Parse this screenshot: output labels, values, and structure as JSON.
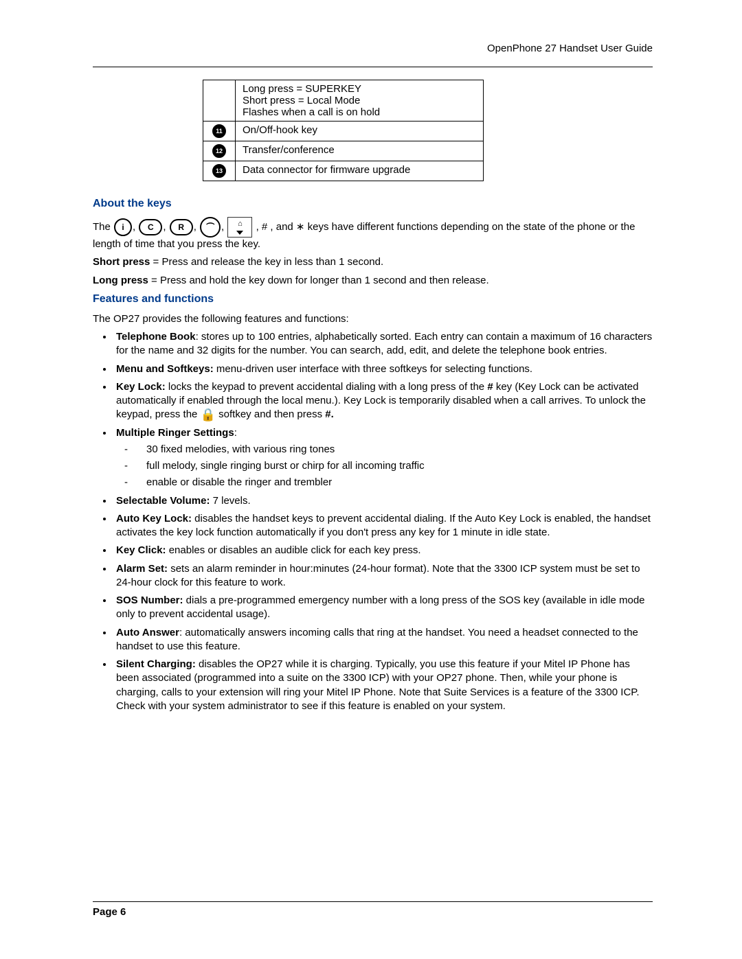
{
  "header": {
    "title": "OpenPhone 27 Handset User Guide"
  },
  "table": {
    "row0": {
      "a": "Long press = SUPERKEY",
      "b": "Short press = Local Mode",
      "c": "Flashes when a call is on hold"
    },
    "row1": {
      "num": "11",
      "text": "On/Off-hook key"
    },
    "row2": {
      "num": "12",
      "text": "Transfer/conference"
    },
    "row3": {
      "num": "13",
      "text": "Data connector for firmware upgrade"
    }
  },
  "sections": {
    "about": {
      "title": "About the keys",
      "para1a": "The ",
      "para1b": ", # , and ∗ keys have different functions depending on the state of the phone or the length of time that you press the key.",
      "short_label": "Short press",
      "short_text": " = Press and release the key in less than 1 second.",
      "long_label": "Long press",
      "long_text": " = Press and hold the key down for longer than 1 second and then release."
    },
    "features": {
      "title": "Features and functions",
      "intro": "The OP27 provides the following features and functions:",
      "tel_book_label": "Telephone Book",
      "tel_book_text": ": stores up to 100 entries, alphabetically sorted. Each entry can contain a maximum of 16 characters for the name and 32 digits for the number. You can search, add, edit, and delete the telephone book entries.",
      "menu_label": "Menu and Softkeys:",
      "menu_text": " menu-driven user interface with three softkeys for selecting functions.",
      "keylock_label": "Key Lock:",
      "keylock_text1": " locks the keypad to prevent accidental dialing with a long press of the ",
      "keylock_hash": "#",
      "keylock_text2": " key (Key Lock can be activated automatically if enabled through the local menu.). Key Lock is temporarily disabled when a call arrives. To unlock the keypad, press the ",
      "keylock_text3": " softkey and then press ",
      "keylock_hash2": "#.",
      "ringer_label": "Multiple Ringer Settings",
      "ringer_colon": ":",
      "ringer_i1": "30 fixed melodies, with various ring tones",
      "ringer_i2": "full melody, single ringing burst or chirp for all incoming traffic",
      "ringer_i3": "enable or disable the ringer and trembler",
      "volume_label": "Selectable Volume:",
      "volume_text": " 7 levels.",
      "autokey_label": "Auto Key Lock:",
      "autokey_text": " disables the handset keys to prevent accidental dialing. If the Auto Key Lock is enabled, the handset activates the key lock function automatically if you don't press any key for 1 minute in idle state.",
      "click_label": "Key Click:",
      "click_text": " enables or disables an audible click for each key press.",
      "alarm_label": "Alarm Set:",
      "alarm_text": " sets an alarm reminder in hour:minutes (24-hour format). Note that the 3300 ICP system must be set to 24-hour clock for this feature to work.",
      "sos_label": "SOS Number:",
      "sos_text": " dials a pre-programmed emergency number with a long press of the SOS key (available in idle mode only to prevent accidental usage).",
      "auto_ans_label": "Auto Answer",
      "auto_ans_text": ": automatically answers incoming calls that ring at the handset. You need a headset connected to the handset to use this feature.",
      "silent_label": "Silent Charging:",
      "silent_text": " disables the OP27 while it is charging. Typically, you use this feature if your Mitel IP Phone has been associated (programmed into a suite on the 3300 ICP) with your OP27 phone. Then, while your phone is charging, calls to your extension will ring your Mitel IP Phone. Note that Suite Services is a feature of the 3300 ICP. Check with your system administrator to see if this feature is enabled on your system."
    }
  },
  "footer": {
    "page_label": "Page 6"
  }
}
